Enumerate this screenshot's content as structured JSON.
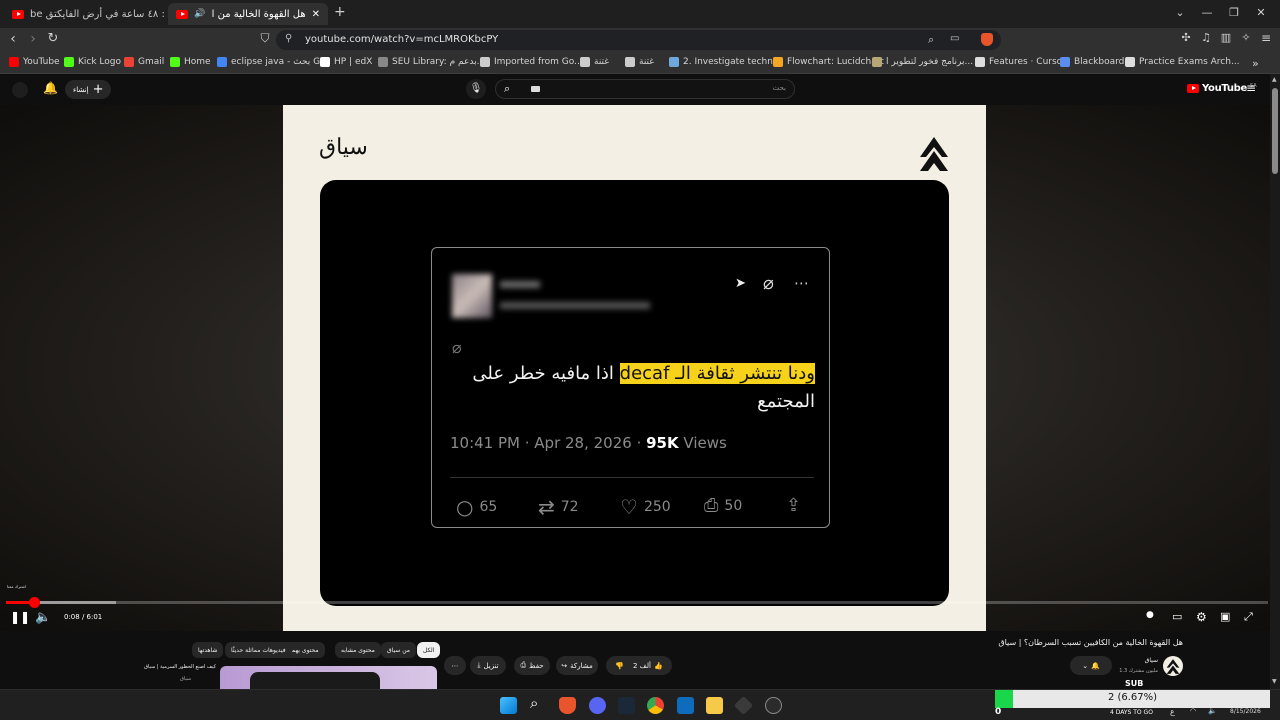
{
  "browser": {
    "tabs": [
      {
        "title": "التروبع: ٤٨ ساعة في أرض الفايكتق be",
        "active": false
      },
      {
        "title": "هل القهوة الخالية من الكافيين ت",
        "active": true
      }
    ],
    "new_tab_label": "+",
    "url": "youtube.com/watch?v=mcLMROKbcPY"
  },
  "bookmarks": [
    {
      "label": "YouTube",
      "color": "#ff0000"
    },
    {
      "label": "Kick Logo",
      "color": "#53fc18"
    },
    {
      "label": "Gmail",
      "color": "#ea4335"
    },
    {
      "label": "Home",
      "color": "#53fc18"
    },
    {
      "label": "eclipse java - بحث G...",
      "color": "#4285f4"
    },
    {
      "label": "HP | edX",
      "color": "#ffffff"
    },
    {
      "label": "SEU Library: بدعم م...",
      "color": "#888888"
    },
    {
      "label": "Imported from Go...",
      "color": "#cccccc"
    },
    {
      "label": "غتنة",
      "color": "#cccccc"
    },
    {
      "label": "غتنة",
      "color": "#cccccc"
    },
    {
      "label": "2. Investigate techni...",
      "color": "#6fa8dc"
    },
    {
      "label": "Flowchart: Lucidchart",
      "color": "#f5a623"
    },
    {
      "label": "برنامج فخور لتطوير ا...",
      "color": "#b7a676"
    },
    {
      "label": "Features · Cursor",
      "color": "#dddddd"
    },
    {
      "label": "Blackboard",
      "color": "#5b8def"
    },
    {
      "label": "Practice Exams Arch...",
      "color": "#dddddd"
    }
  ],
  "youtube": {
    "create_label": "إنشاء",
    "search_placeholder": "بحث",
    "logo_text": "YouTube",
    "logo_region": "SA"
  },
  "slide": {
    "brand": "سياق",
    "tweet": {
      "text_highlight": "ودنا تنتشر ثقافة الـ decaf",
      "text_rest": " اذا مافيه خطر على المجتمع",
      "time": "10:41 PM · Apr 28, 2026",
      "views_count": "95K",
      "views_label": " Views",
      "replies": "65",
      "retweets": "72",
      "likes": "250",
      "bookmarks": "50"
    }
  },
  "player": {
    "time": "0:08 / 6:01",
    "progress_fraction": 0.022,
    "chapter_label": "اشترك معنا"
  },
  "below_video": {
    "video_title": "هل القهوة الخالية من الكافيين تسبب السرطان؟ | سياق",
    "channel_name": "سياق",
    "subscribers": "1.3 مليون مشترك",
    "like_count": "2 ألف",
    "share_label": "مشاركة",
    "save_label": "حفظ",
    "download_label": "تنزيل",
    "chips": [
      "الكل",
      "من سياق",
      "محتوى مشابه",
      "محتوى يهمك",
      "فيديوهات مماثلة حديثًا",
      "شاهدتها"
    ],
    "next_video_title": "كيف أُصنع الحظور السرمية | سياق",
    "next_video_channel": "سياق"
  },
  "taskbar": {
    "sub_goal_label": "2 (6.67%)",
    "sub_goal_fraction": 0.0667,
    "sub_goal_start": "0",
    "sub_label": "SUB",
    "days_to_go": "4 DAYS TO GO",
    "lang": "ع",
    "date": "8/15/2026"
  }
}
